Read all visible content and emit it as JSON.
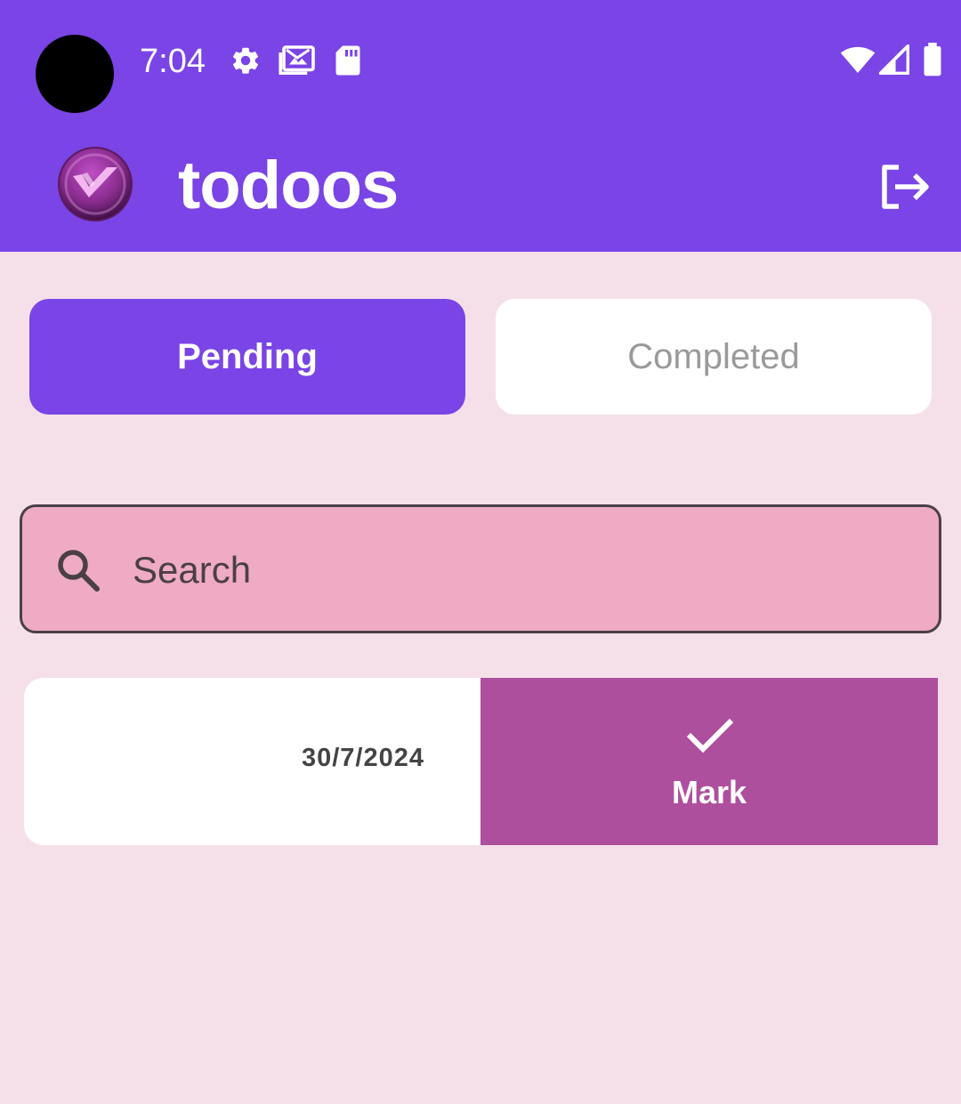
{
  "status_bar": {
    "time": "7:04",
    "icons": [
      "gear-icon",
      "gallery-icon",
      "sd-card-icon",
      "wifi-icon",
      "signal-icon",
      "battery-icon"
    ]
  },
  "app_bar": {
    "title": "todoos",
    "logo": "todoos-logo",
    "action_icon": "logout-icon"
  },
  "tabs": [
    {
      "label": "Pending",
      "selected": true
    },
    {
      "label": "Completed",
      "selected": false
    }
  ],
  "search": {
    "placeholder": "Search",
    "value": ""
  },
  "todos": [
    {
      "date": "30/7/2024",
      "swipe_action": {
        "label": "Mark",
        "icon": "check-icon"
      }
    }
  ],
  "colors": {
    "primary": "#7a44e6",
    "background": "#f5e0e9",
    "search_fill": "#f0abc4",
    "swipe_action": "#ae4f9e"
  }
}
